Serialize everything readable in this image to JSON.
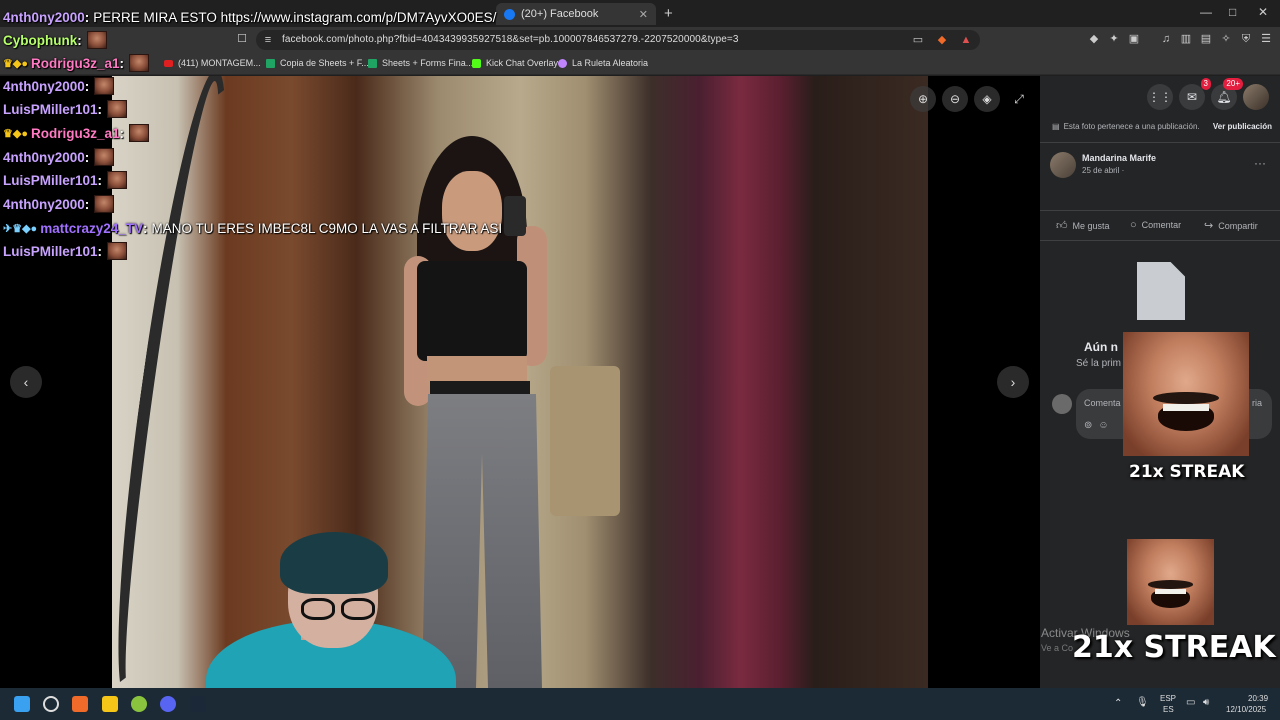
{
  "browser": {
    "tabs": [
      {
        "label": "(20+) Facebook"
      }
    ],
    "url": "facebook.com/photo.php?fbid=4043439935927518&set=pb.100007846537279.-2207520000&type=3",
    "bookmarks": [
      {
        "label": "(411) MONTAGEM..."
      },
      {
        "label": "Copia de Sheets + F..."
      },
      {
        "label": "Sheets + Forms Fina..."
      },
      {
        "label": "Kick Chat Overlay"
      },
      {
        "label": "La Ruleta Aleatoria"
      }
    ],
    "window_controls": {
      "minimize": "—",
      "maximize": "□",
      "close": "✕"
    }
  },
  "chat": {
    "messages": [
      {
        "user": "4nth0ny2000",
        "user_color": "#c8a2ff",
        "text": "PERRE MIRA ESTO https://www.instagram.com/p/DM7AyvXO0ES/"
      },
      {
        "user": "Cybophunk",
        "user_color": "#b6ff6a",
        "text": ""
      },
      {
        "user": "Rodrigu3z_a1",
        "user_color": "#ff7ac2",
        "text": ""
      },
      {
        "user": "4nth0ny2000",
        "user_color": "#c8a2ff",
        "text": ""
      },
      {
        "user": "LuisPMiller101",
        "user_color": "#c8a2ff",
        "text": ""
      },
      {
        "user": "Rodrigu3z_a1",
        "user_color": "#ff7ac2",
        "text": ""
      },
      {
        "user": "4nth0ny2000",
        "user_color": "#c8a2ff",
        "text": ""
      },
      {
        "user": "LuisPMiller101",
        "user_color": "#c8a2ff",
        "text": ""
      },
      {
        "user": "4nth0ny2000",
        "user_color": "#c8a2ff",
        "text": ""
      },
      {
        "user": "mattcrazy24_TV",
        "user_color": "#a070ff",
        "text": "MANO TU ERES IMBEC8L C9MO LA VAS A FILTRAR ASI"
      },
      {
        "user": "LuisPMiller101",
        "user_color": "#c8a2ff",
        "text": ""
      }
    ]
  },
  "panel": {
    "top_icons": [
      {
        "name": "menu-grid",
        "badge": ""
      },
      {
        "name": "messenger",
        "badge": "3"
      },
      {
        "name": "notifications",
        "badge": "20+"
      }
    ],
    "belongs_text": "Esta foto pertenece a una publicación.",
    "belongs_link": "Ver publicación",
    "author": "Mandarina Marife",
    "date": "25 de abril ·",
    "actions": {
      "like": "Me gusta",
      "comment": "Comentar",
      "share": "Compartir"
    },
    "empty_title": "Aún n",
    "empty_sub": "Sé la prim",
    "comment_placeholder": "Comenta",
    "comment_tail": "ria"
  },
  "overlay": {
    "streak_small": "21x STREAK",
    "streak_large": "21x STREAK",
    "activate_title": "Activar Windows",
    "activate_sub": "Ve a Co"
  },
  "taskbar": {
    "lang_top": "ESP",
    "lang_bottom": "ES",
    "time": "20:39",
    "date": "12/10/2025"
  },
  "colors": {
    "facebook_blue": "#1877f2",
    "panel_bg": "#242526",
    "taskbar_bg": "#1c2a36",
    "shirt": "#1fa3b5"
  }
}
